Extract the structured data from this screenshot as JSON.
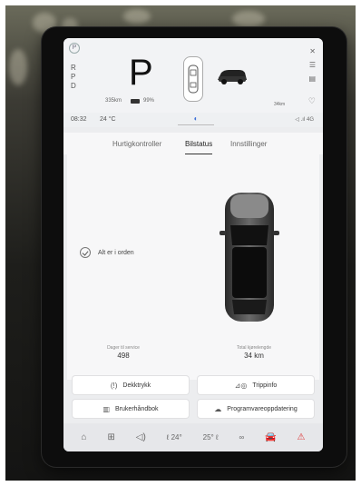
{
  "status": {
    "gear_big": "P",
    "gears": [
      "R",
      "P",
      "D"
    ],
    "range": "335km",
    "battery_pct": "99%",
    "range_right": "34km"
  },
  "infobar": {
    "time": "08:32",
    "temp": "24 °C",
    "signal": "4G"
  },
  "tabs": {
    "quick": "Hurtigkontroller",
    "status": "Bilstatus",
    "settings": "Innstillinger"
  },
  "car_status": {
    "ok_text": "Alt er i orden"
  },
  "stats": {
    "service_label": "Dager til service",
    "service_value": "498",
    "mileage_label": "Total kjørelengde",
    "mileage_value": "34 km"
  },
  "actions": {
    "tyre": "Dekktrykk",
    "trip": "Trippinfo",
    "manual": "Brukerhåndbok",
    "update": "Programvareoppdatering"
  },
  "dock": {
    "temp_left": "24°",
    "temp_right": "25°"
  },
  "colors": {
    "accent": "#3a6fd8",
    "hazard": "#dd3333"
  }
}
